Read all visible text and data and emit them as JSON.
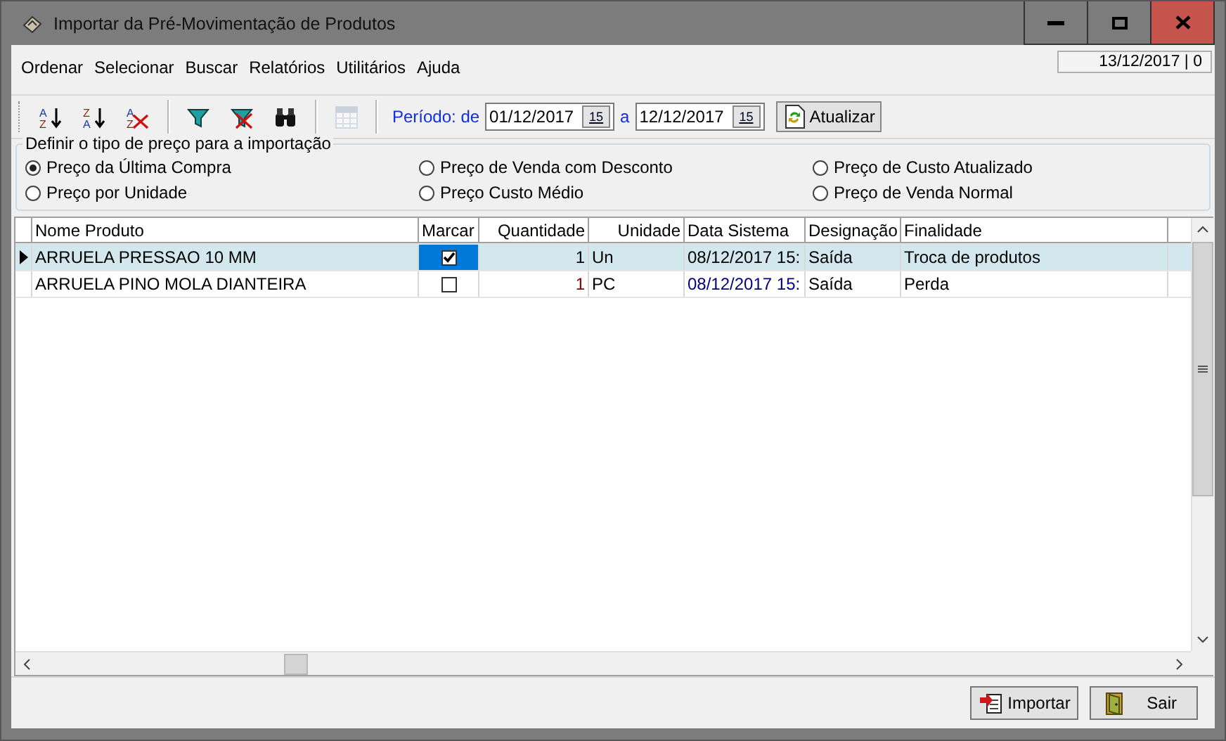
{
  "window": {
    "title": "Importar da Pré-Movimentação de Produtos"
  },
  "menu": [
    {
      "label": "Ordenar"
    },
    {
      "label": "Selecionar"
    },
    {
      "label": "Buscar"
    },
    {
      "label": "Relatórios"
    },
    {
      "label": "Utilitários"
    },
    {
      "label": "Ajuda"
    }
  ],
  "status_date": "13/12/2017 | 0",
  "toolbar": {
    "buttons": [
      {
        "kind": "sort-asc",
        "disabled": false,
        "glyphs": [
          "A",
          "Z"
        ]
      },
      {
        "kind": "sort-desc",
        "disabled": false,
        "glyphs": [
          "Z",
          "A"
        ]
      },
      {
        "kind": "sort-clear",
        "disabled": false,
        "glyphs": [
          "A",
          "Z"
        ]
      },
      {
        "kind": "filter",
        "disabled": false
      },
      {
        "kind": "filter-clear",
        "disabled": false
      },
      {
        "kind": "find",
        "disabled": false
      },
      {
        "kind": "grid",
        "disabled": true
      }
    ],
    "period_label": "Período: de",
    "date_from": {
      "value": "01/12/2017",
      "calendar": "15"
    },
    "to_label": "a",
    "date_to": {
      "value": "12/12/2017",
      "calendar": "15"
    },
    "refresh_button": "Atualizar"
  },
  "price_type": {
    "legend": "Definir o tipo de preço para a importação",
    "options": [
      {
        "label": "Preço da Última Compra",
        "selected": true
      },
      {
        "label": "Preço de Venda com Desconto",
        "selected": false
      },
      {
        "label": "Preço de Custo Atualizado",
        "selected": false
      },
      {
        "label": "Preço por Unidade",
        "selected": false
      },
      {
        "label": "Preço Custo Médio",
        "selected": false
      },
      {
        "label": "Preço de Venda Normal",
        "selected": false
      }
    ]
  },
  "grid": {
    "columns": [
      "Nome Produto",
      "Marcar",
      "Quantidade",
      "Unidade",
      "Data Sistema",
      "Designação",
      "Finalidade"
    ],
    "rows": [
      {
        "selected": true,
        "cells": [
          {
            "text": "ARRUELA PRESSAO 10 MM"
          },
          {
            "kind": "checkbox",
            "checked": true
          },
          {
            "text": "1"
          },
          {
            "text": "Un"
          },
          {
            "text": "08/12/2017 15:"
          },
          {
            "text": "Saída"
          },
          {
            "text": "Troca de produtos"
          }
        ]
      },
      {
        "selected": false,
        "cells": [
          {
            "text": "ARRUELA PINO MOLA DIANTEIRA"
          },
          {
            "kind": "checkbox",
            "checked": false
          },
          {
            "text": "1",
            "color": "#800000"
          },
          {
            "text": "PC"
          },
          {
            "text": "08/12/2017 15:",
            "color": "#000080"
          },
          {
            "text": "Saída"
          },
          {
            "text": "Perda"
          }
        ]
      }
    ]
  },
  "footer": {
    "buttons": [
      {
        "kind": "import",
        "label": "Importar"
      },
      {
        "kind": "exit",
        "label": "Sair"
      }
    ]
  }
}
